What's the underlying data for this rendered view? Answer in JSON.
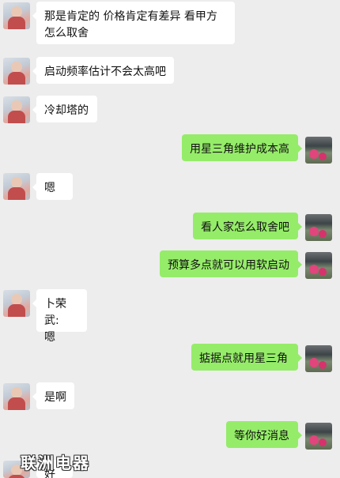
{
  "messages": [
    {
      "side": "in",
      "text": "那是肯定的   价格肯定有差异  看甲方",
      "text2": "怎么取舍"
    },
    {
      "side": "in",
      "text": "启动频率估计不会太高吧"
    },
    {
      "side": "in",
      "text": "冷却塔的"
    },
    {
      "side": "out",
      "text": "用星三角维护成本高"
    },
    {
      "side": "in",
      "text": "嗯"
    },
    {
      "side": "out",
      "text": "看人家怎么取舍吧"
    },
    {
      "side": "out",
      "text": "预算多点就可以用软启动"
    },
    {
      "side": "in",
      "sender": "卜荣武:",
      "text": "嗯"
    },
    {
      "side": "out",
      "text": "掂据点就用星三角"
    },
    {
      "side": "in",
      "text": "是啊"
    },
    {
      "side": "out",
      "text": "等你好消息"
    },
    {
      "side": "in",
      "text": "好"
    }
  ],
  "watermark": "联洲电器"
}
